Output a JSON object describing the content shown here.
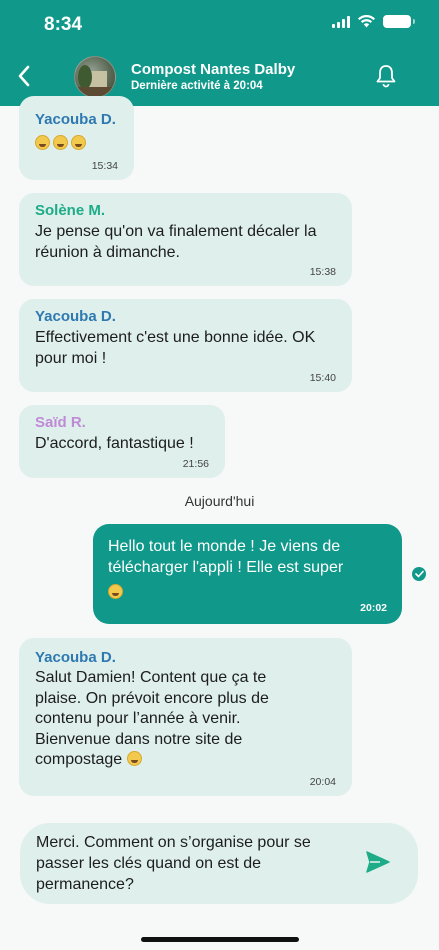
{
  "status_bar": {
    "time": "8:34"
  },
  "header": {
    "title": "Compost Nantes Dalby",
    "subtitle": "Dernière activité à 20:04"
  },
  "messages": [
    {
      "sender": "Yacouba D.",
      "text": "😂😂😂",
      "time": "15:34",
      "sender_color": "#2f79b1"
    },
    {
      "sender": "Solène M.",
      "text": "Je pense qu'on va finalement décaler la réunion à dimanche.",
      "time": "15:38",
      "sender_color": "#1eac88"
    },
    {
      "sender": "Yacouba D.",
      "text": "Effectivement c'est une bonne idée. OK pour moi !",
      "time": "15:40",
      "sender_color": "#2f79b1"
    },
    {
      "sender": "Saïd R.",
      "text": "D'accord, fantastique !",
      "time": "21:56",
      "sender_color": "#c08ad6"
    }
  ],
  "day_separator": "Aujourd'hui",
  "own_message": {
    "text": "Hello tout le monde ! Je viens de télécharger l'appli ! Elle est super",
    "time": "20:02"
  },
  "reply": {
    "sender": "Yacouba D.",
    "text": "Salut Damien! Content que ça te plaise. On prévoit encore plus de contenu pour l’année à venir. Bienvenue dans notre site de compostage",
    "time": "20:04"
  },
  "composer": {
    "value": "Merci. Comment on s’organise pour se passer les clés quand on est de permanence?"
  },
  "colors": {
    "accent": "#10998a",
    "bubble": "#deefec"
  },
  "icons": [
    "back-arrow-icon",
    "group-avatar",
    "bell-icon",
    "check-icon",
    "send-icon",
    "wifi-icon",
    "battery-icon"
  ]
}
